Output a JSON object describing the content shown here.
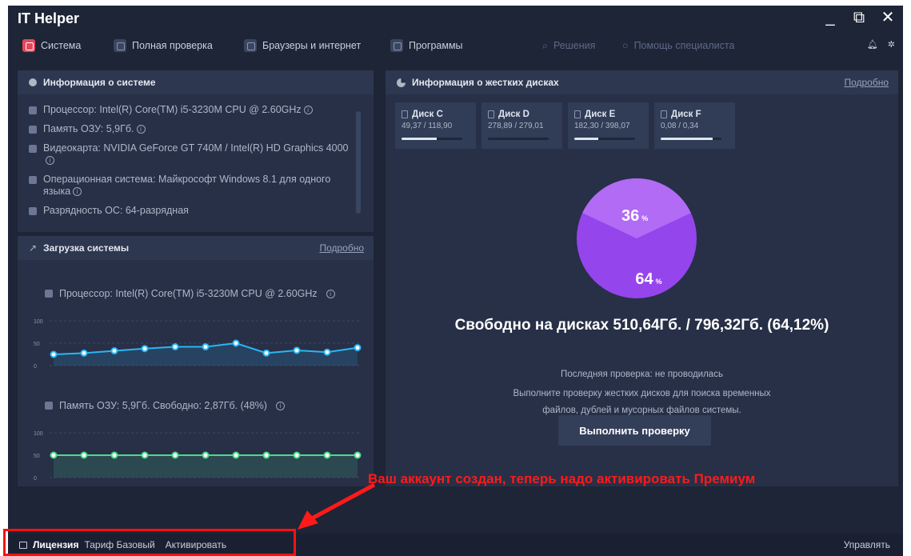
{
  "app": {
    "title": "IT Helper"
  },
  "window_controls": {
    "minimize": "_",
    "maximize": "⧉",
    "close": "✕"
  },
  "nav": {
    "items": [
      {
        "label": "Система",
        "active": true
      },
      {
        "label": "Полная проверка"
      },
      {
        "label": "Браузеры и интернет"
      },
      {
        "label": "Программы"
      }
    ],
    "solutions": "Решения",
    "help": "Помощь специалиста",
    "bell_icon": "bell-icon",
    "settings_icon": "gear-icon"
  },
  "system_info": {
    "title": "Информация о системе",
    "rows": [
      "Процессор: Intel(R) Core(TM) i5-3230M CPU @ 2.60GHz",
      "Память ОЗУ:  5,9Гб.",
      "Видеокарта: NVIDIA GeForce GT 740M / Intel(R) HD Graphics 4000",
      "Операционная система: Майкрософт Windows 8.1 для одного языка",
      "Разрядность ОС:  64-разрядная"
    ]
  },
  "system_load": {
    "title": "Загрузка системы",
    "link": "Подробно",
    "cpu_label": "Процессор: Intel(R) Core(TM) i5-3230M CPU @ 2.60GHz",
    "ram_label": "Память ОЗУ: 5,9Гб. Свободно: 2,87Гб. (48%)",
    "y_ticks": [
      "100",
      "50",
      "0"
    ],
    "cpu_values": [
      25,
      28,
      33,
      38,
      42,
      42,
      50,
      28,
      34,
      30,
      40
    ],
    "ram_values": [
      50,
      50,
      50,
      50,
      50,
      50,
      50,
      50,
      50,
      50,
      50
    ],
    "cpu_color": "#29b6f6",
    "ram_color": "#4cd98a"
  },
  "disks": {
    "title": "Информация о жестких дисках",
    "link": "Подробно",
    "cards": [
      {
        "name": "Диск C",
        "value": "49,37 / 118,90",
        "fill": 0.58
      },
      {
        "name": "Диск D",
        "value": "278,89 / 279,01",
        "fill": 0.0
      },
      {
        "name": "Диск E",
        "value": "182,30 / 398,07",
        "fill": 0.4
      },
      {
        "name": "Диск F",
        "value": "0,08 / 0,34",
        "fill": 0.86
      }
    ],
    "pie": {
      "used_pct": "36",
      "free_pct": "64",
      "unit": "%",
      "used_color": "#b26bf4",
      "free_color": "#9545ec"
    },
    "free_summary": "Свободно на дисках  510,64Гб. / 796,32Гб. (64,12%)",
    "last_check": "Последняя проверка: не проводилась",
    "hint_line1": "Выполните проверку жестких дисков для поиска временных",
    "hint_line2": "файлов, дублей и мусорных файлов системы.",
    "button": "Выполнить проверку"
  },
  "bottom": {
    "license": "Лицензия",
    "tariff": "Тариф Базовый",
    "activate": "Активировать",
    "manage": "Управлять"
  },
  "annotation": "Ваш аккаунт создан, теперь надо активировать Премиум"
}
